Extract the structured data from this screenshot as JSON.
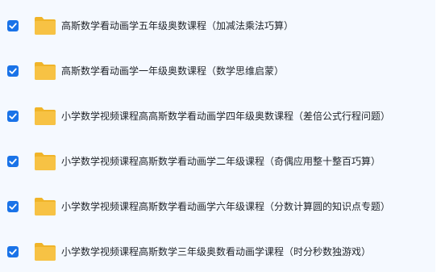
{
  "files": [
    {
      "name": "高斯数学看动画学五年级奥数课程（加减法乘法巧算）",
      "checked": true,
      "icon": "folder-icon"
    },
    {
      "name": "高斯数学看动画学一年级奥数课程（数学思维启蒙）",
      "checked": true,
      "icon": "folder-icon"
    },
    {
      "name": "小学数学视频课程高高斯数学看动画学四年级奥数课程（差倍公式行程问题）",
      "checked": true,
      "icon": "folder-icon"
    },
    {
      "name": "小学数学视频课程高斯数学看动画学二年级课程（奇偶应用整十整百巧算）",
      "checked": true,
      "icon": "folder-icon"
    },
    {
      "name": "小学数学视频课程高斯数学看动画学六年级课程（分数计算圆的知识点专题）",
      "checked": true,
      "icon": "folder-icon"
    },
    {
      "name": "小学数学视频课程高斯数学三年级奥数看动画学课程（时分秒数独游戏）",
      "checked": true,
      "icon": "folder-icon"
    }
  ],
  "colors": {
    "checkbox": "#1a73e8",
    "folder": "#f7c244",
    "folder_tab": "#f0b429",
    "background": "#f5f9ff"
  }
}
